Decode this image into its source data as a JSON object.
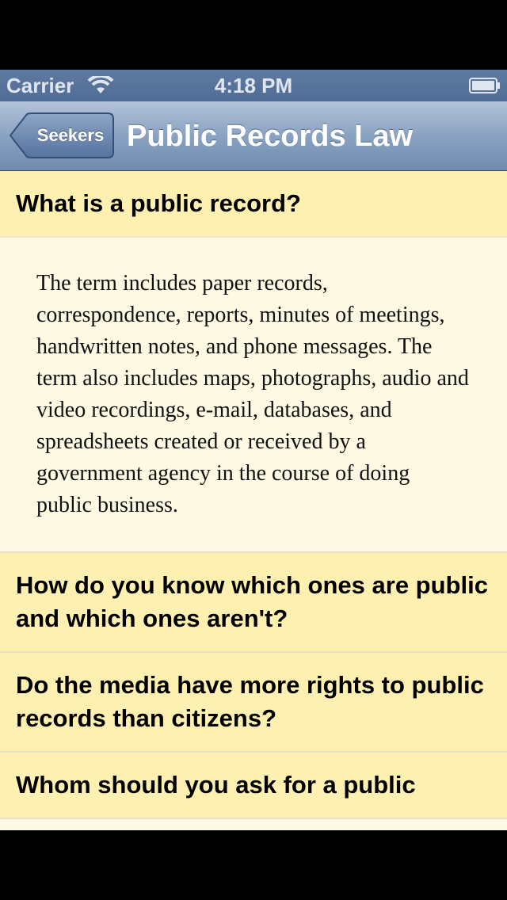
{
  "status_bar": {
    "carrier": "Carrier",
    "time": "4:18 PM",
    "icons": [
      "wifi-icon",
      "battery-icon"
    ]
  },
  "nav_bar": {
    "back_label": "Seekers",
    "title": "Public Records Law"
  },
  "faq": [
    {
      "question": "What is a public record?",
      "expanded": true,
      "answer": "The term includes paper records, correspondence, reports, minutes of meetings, handwritten notes, and phone messages. The term also includes maps, photographs, audio and video recordings, e-mail, databases, and spreadsheets created or received by a government agency in the course of doing public business."
    },
    {
      "question": "How do you know which ones are public and which ones aren't?",
      "expanded": false
    },
    {
      "question": "Do the media have more rights to public records than citizens?",
      "expanded": false
    },
    {
      "question": "Whom should you ask for a public",
      "expanded": false
    }
  ],
  "colors": {
    "question_bg": "#fef0b0",
    "answer_bg": "#fef9e2",
    "nav_bar": "#8aa2c2",
    "status_bar": "#506d96"
  }
}
